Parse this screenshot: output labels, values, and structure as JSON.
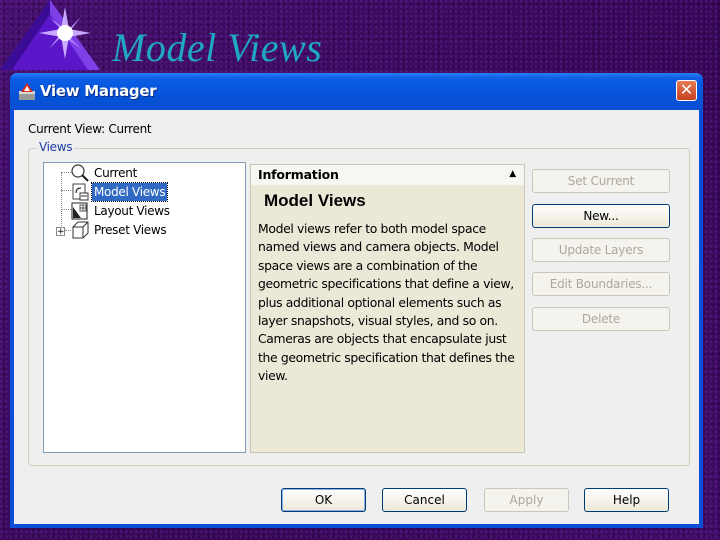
{
  "slide": {
    "title": "Model Views"
  },
  "dialog": {
    "title": "View Manager",
    "close_label": "✕",
    "current_view_label": "Current View: Current",
    "views_group_label": "Views",
    "tree": [
      {
        "label": "Current",
        "icon": "magnifier-icon",
        "selected": false
      },
      {
        "label": "Model Views",
        "icon": "model-views-icon",
        "selected": true
      },
      {
        "label": "Layout Views",
        "icon": "layout-views-icon",
        "selected": false
      },
      {
        "label": "Preset Views",
        "icon": "cube-icon",
        "selected": false,
        "expandable": true
      }
    ],
    "expander_label": "+",
    "info": {
      "header": "Information",
      "collapse_glyph": "▲",
      "title": "Model Views",
      "body": "Model views refer to both model space named views and camera objects. Model space views are a combination of the geometric specifications that define a view, plus additional optional elements such as layer snapshots, visual styles, and so on. Cameras are objects that encapsulate just the geometric specification that defines the view."
    },
    "side_buttons": [
      {
        "label": "Set Current",
        "enabled": false
      },
      {
        "label": "New...",
        "enabled": true
      },
      {
        "label": "Update Layers",
        "enabled": false
      },
      {
        "label": "Edit Boundaries...",
        "enabled": false
      },
      {
        "label": "Delete",
        "enabled": false
      }
    ],
    "bottom_buttons": [
      {
        "label": "OK",
        "enabled": true
      },
      {
        "label": "Cancel",
        "enabled": true
      },
      {
        "label": "Apply",
        "enabled": false
      },
      {
        "label": "Help",
        "enabled": true
      }
    ]
  },
  "colors": {
    "title_text": "#1fa7c4",
    "titlebar": "#0553d8",
    "selection": "#316ac5",
    "info_bg": "#ebe8d8"
  }
}
